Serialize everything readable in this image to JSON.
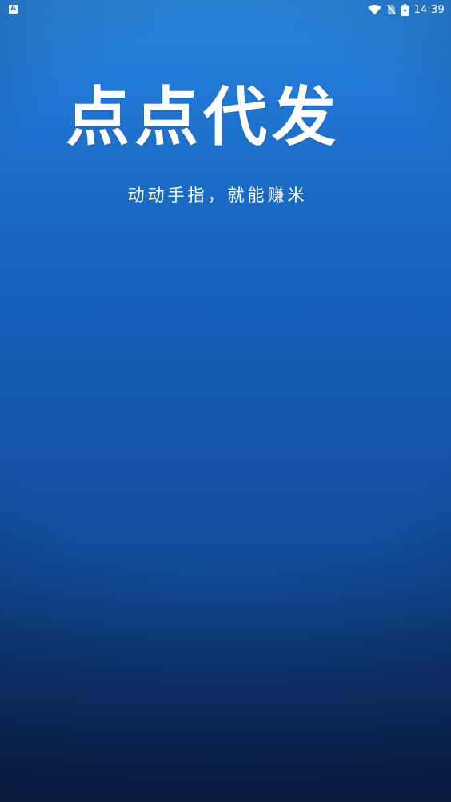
{
  "status_bar": {
    "notification_icon_label": "A",
    "time": "14:39",
    "icons": [
      "wifi-icon",
      "no-sim-icon",
      "battery-charging-icon"
    ]
  },
  "splash": {
    "app_name": "点点代发",
    "slogan": "动动手指，就能赚米"
  },
  "colors": {
    "background_top": "#2a86dc",
    "background_middle": "#1458b2",
    "background_bottom": "#0a2450",
    "text": "#ffffff"
  }
}
